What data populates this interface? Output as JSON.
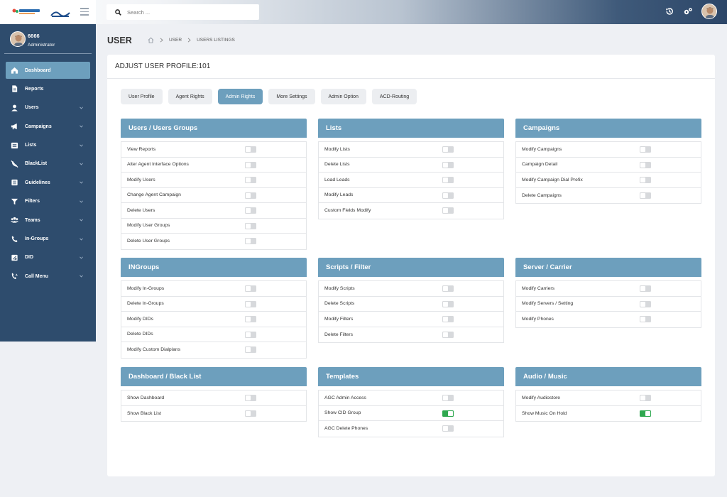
{
  "header": {
    "search_placeholder": "Search ...",
    "icons": [
      "history-icon",
      "cogs-icon",
      "avatar"
    ]
  },
  "user": {
    "name": "6666",
    "role": "Administrator"
  },
  "sidebar": {
    "items": [
      {
        "label": "Dashboard",
        "icon": "home-icon",
        "active": true,
        "caret": false
      },
      {
        "label": "Reports",
        "icon": "file-icon",
        "caret": false
      },
      {
        "label": "Users",
        "icon": "user-icon",
        "caret": true
      },
      {
        "label": "Campaigns",
        "icon": "megaphone-icon",
        "caret": true
      },
      {
        "label": "Lists",
        "icon": "list-icon",
        "caret": true
      },
      {
        "label": "BlackList",
        "icon": "phone-slash-icon",
        "caret": true
      },
      {
        "label": "Guidelines",
        "icon": "book-icon",
        "caret": true
      },
      {
        "label": "Filters",
        "icon": "filter-icon",
        "caret": true
      },
      {
        "label": "Teams",
        "icon": "users-icon",
        "caret": true
      },
      {
        "label": "In-Groups",
        "icon": "phone-icon",
        "caret": true
      },
      {
        "label": "DID",
        "icon": "did-icon",
        "caret": true
      },
      {
        "label": "Call Menu",
        "icon": "phone-volume-icon",
        "caret": true
      }
    ]
  },
  "page": {
    "title": "USER",
    "breadcrumb": [
      "USER",
      "USERS LISTINGS"
    ],
    "card_title": "ADJUST USER PROFILE:101"
  },
  "tabs": [
    "User Profile",
    "Agent Rights",
    "Admin Rights",
    "More Settings",
    "Admin Option",
    "ACD-Routing"
  ],
  "active_tab": "Admin Rights",
  "colors": {
    "sidebar": "#2e4c6d",
    "accent": "#6d9fbd",
    "toggle_on": "#2fa84f"
  },
  "panels": [
    {
      "title": "Users / Users Groups",
      "items": [
        {
          "label": "View Reports",
          "on": false
        },
        {
          "label": "Alter Agent Interface Options",
          "on": false
        },
        {
          "label": "Modify Users",
          "on": false
        },
        {
          "label": "Change Agent Campaign",
          "on": false
        },
        {
          "label": "Delete Users",
          "on": false
        },
        {
          "label": "Modify User Groups",
          "on": false
        },
        {
          "label": "Delete User Groups",
          "on": false
        }
      ]
    },
    {
      "title": "Lists",
      "items": [
        {
          "label": "Modify Lists",
          "on": false
        },
        {
          "label": "Delete Lists",
          "on": false
        },
        {
          "label": "Load Leads",
          "on": false
        },
        {
          "label": "Modify Leads",
          "on": false
        },
        {
          "label": "Custom Fields Modify",
          "on": false
        }
      ]
    },
    {
      "title": "Campaigns",
      "items": [
        {
          "label": "Modify Campaigns",
          "on": false
        },
        {
          "label": "Campaign Detail",
          "on": false
        },
        {
          "label": "Modify Campaign Dial Prefix",
          "on": false
        },
        {
          "label": "Delete Campaigns",
          "on": false
        }
      ]
    },
    {
      "title": "INGroups",
      "items": [
        {
          "label": "Modify In-Groups",
          "on": false
        },
        {
          "label": "Delete In-Groups",
          "on": false
        },
        {
          "label": "Modify DIDs",
          "on": false
        },
        {
          "label": "Delete DIDs",
          "on": false
        },
        {
          "label": "Modify Custom Dialplans",
          "on": false
        }
      ]
    },
    {
      "title": "Scripts / Filter",
      "items": [
        {
          "label": "Modify Scripts",
          "on": false
        },
        {
          "label": "Delete Scripts",
          "on": false
        },
        {
          "label": "Modify Filters",
          "on": false
        },
        {
          "label": "Delete Filters",
          "on": false
        }
      ]
    },
    {
      "title": "Server / Carrier",
      "items": [
        {
          "label": "Modify Carriers",
          "on": false
        },
        {
          "label": "Modify Servers / Setting",
          "on": false
        },
        {
          "label": "Modify Phones",
          "on": false
        }
      ]
    },
    {
      "title": "Dashboard / Black List",
      "items": [
        {
          "label": "Show Dashboard",
          "on": false
        },
        {
          "label": "Show Black List",
          "on": false
        }
      ]
    },
    {
      "title": "Templates",
      "items": [
        {
          "label": "AGC Admin Access",
          "on": false
        },
        {
          "label": "Show CID Group",
          "on": true
        },
        {
          "label": "AGC Delete Phones",
          "on": false
        }
      ]
    },
    {
      "title": "Audio / Music",
      "items": [
        {
          "label": "Modify Audiostore",
          "on": false
        },
        {
          "label": "Show Music On Hold",
          "on": true
        }
      ]
    }
  ]
}
